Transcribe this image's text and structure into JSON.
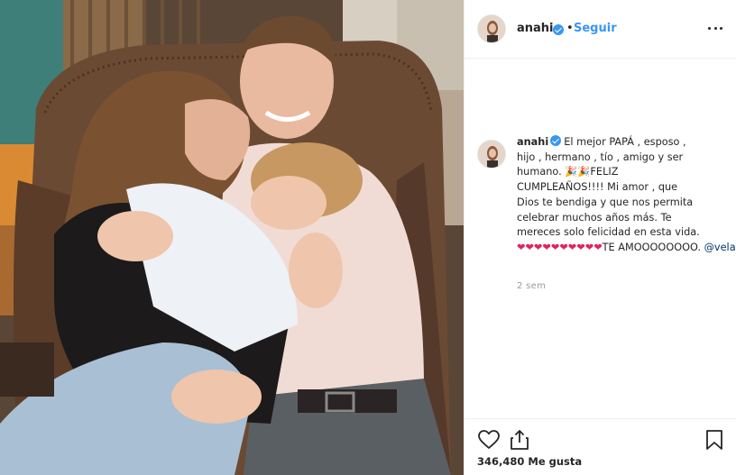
{
  "post": {
    "username": "anahi",
    "follow_label": "Seguir",
    "header_separator": "•",
    "caption": {
      "username": "anahi",
      "lines": [
        "El mejor PAPÁ , esposo ,",
        "hijo , hermano , tío , amigo y ser",
        "humano. 🎉🎉FELIZ",
        "CUMPLEAÑOS!!!! Mi amor , que",
        "Dios te bendiga y que nos permita",
        "celebrar muchos años más. Te",
        "mereces solo felicidad en esta vida."
      ],
      "hearts": "❤❤❤❤❤❤❤❤❤❤",
      "last_text": "TE AMOOOOOOOO.",
      "mention": "@velascom_"
    },
    "time_ago": "2 sem",
    "likes": "346,480 Me gusta"
  },
  "icons": {
    "verified": "verified-badge-icon",
    "more": "more-options-icon",
    "like": "heart-icon",
    "share": "share-icon",
    "save": "bookmark-icon"
  },
  "colors": {
    "link_blue": "#3897f0",
    "mention_blue": "#003569",
    "heart_red": "#e0245e",
    "text": "#262626",
    "muted": "#999999",
    "border": "#efefef"
  }
}
